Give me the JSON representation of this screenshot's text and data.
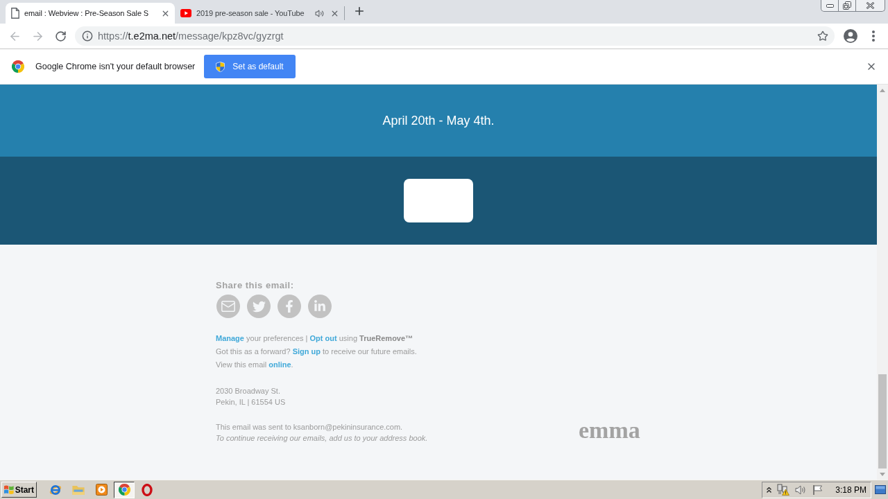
{
  "browser": {
    "tabs": [
      {
        "title": "email : Webview : Pre-Season Sale S",
        "selected": true,
        "audio": false
      },
      {
        "title": "2019 pre-season sale - YouTube",
        "selected": false,
        "audio": true
      }
    ],
    "nav": {
      "back": {
        "disabled": true
      },
      "forward": {
        "disabled": true
      }
    },
    "address": {
      "scheme": "https://",
      "host": "t.e2ma.net",
      "path": "/message/kpz8vc/gyzrgt"
    },
    "infobar": {
      "message": "Google Chrome isn't your default browser",
      "button": "Set as default"
    }
  },
  "email": {
    "dates": "April 20th - May 4th.",
    "share_label": "Share this email:",
    "share_icons": [
      {
        "kind": "email"
      },
      {
        "kind": "twitter"
      },
      {
        "kind": "facebook"
      },
      {
        "kind": "linkedin"
      }
    ],
    "link_lines": [
      [
        {
          "text": "Manage",
          "kind": "link"
        },
        {
          "text": " your preferences | ",
          "kind": "plain"
        },
        {
          "text": "Opt out",
          "kind": "link"
        },
        {
          "text": " using ",
          "kind": "plain"
        },
        {
          "text": "TrueRemove™",
          "kind": "bold"
        }
      ],
      [
        {
          "text": "Got this as a forward? ",
          "kind": "plain"
        },
        {
          "text": "Sign up",
          "kind": "link"
        },
        {
          "text": " to receive our future emails.",
          "kind": "plain"
        }
      ],
      [
        {
          "text": "View this email ",
          "kind": "plain"
        },
        {
          "text": "online",
          "kind": "link"
        },
        {
          "text": ".",
          "kind": "plain"
        }
      ]
    ],
    "address_lines": [
      "2030 Broadway St.",
      "Pekin, IL | 61554 US"
    ],
    "sent_to": "This email was sent to ksanborn@pekininsurance.com.",
    "notice": "To continue receiving our emails, add us to your address book.",
    "logo": "emma"
  },
  "taskbar": {
    "start": "Start",
    "apps": [
      {
        "kind": "ie",
        "selected": false
      },
      {
        "kind": "explorer",
        "selected": false
      },
      {
        "kind": "media",
        "selected": false
      },
      {
        "kind": "chrome",
        "selected": true
      },
      {
        "kind": "opera",
        "selected": false
      }
    ],
    "clock": "3:18 PM"
  }
}
